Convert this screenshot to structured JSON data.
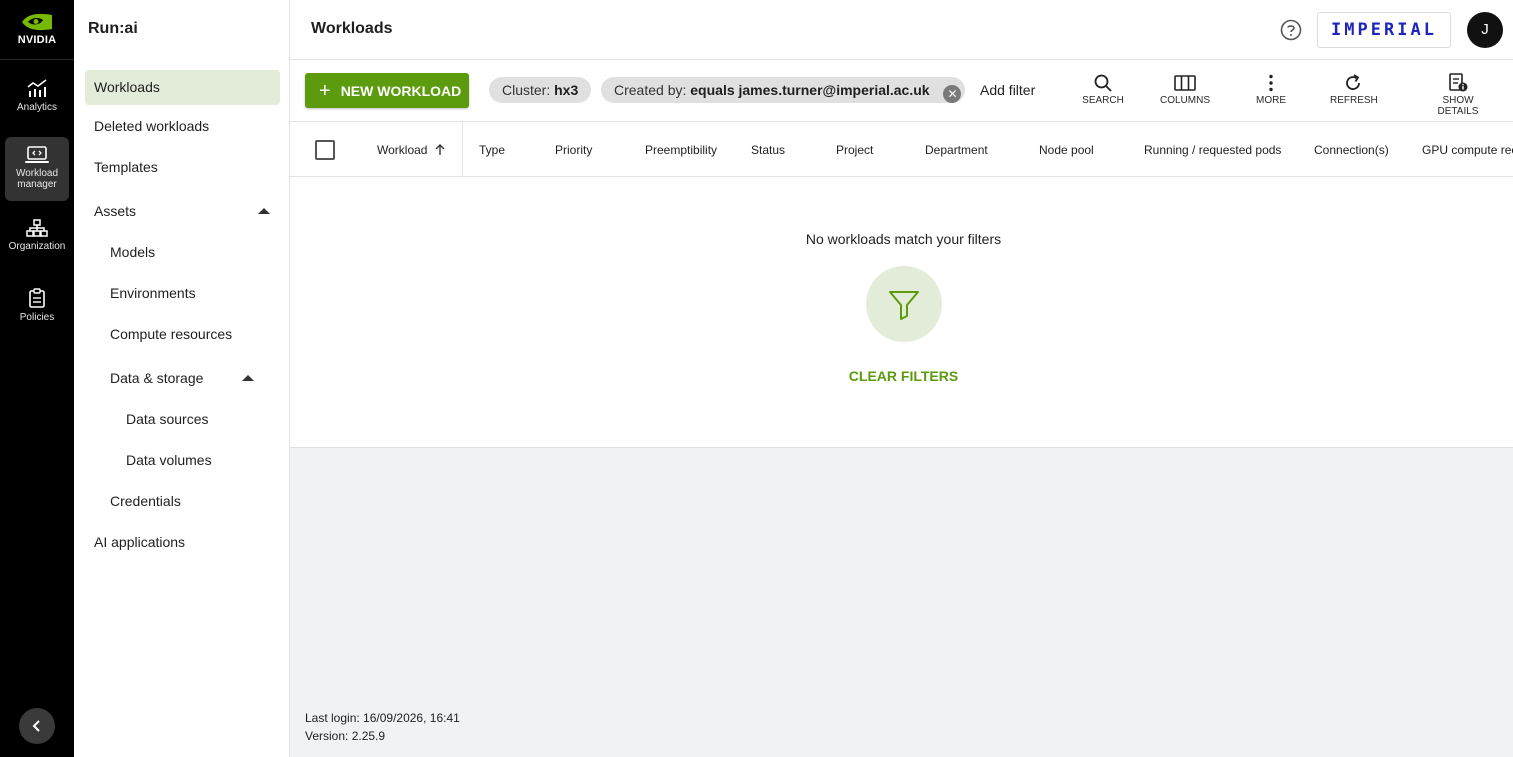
{
  "rail": {
    "brand": "NVIDIA",
    "items": [
      {
        "label": "Analytics",
        "icon": "analytics-icon"
      },
      {
        "label": "Workload manager",
        "icon": "laptop-code-icon"
      },
      {
        "label": "Organization",
        "icon": "org-chart-icon"
      },
      {
        "label": "Policies",
        "icon": "clipboard-icon"
      }
    ]
  },
  "subnav": {
    "title": "Run:ai",
    "items": {
      "workloads": "Workloads",
      "deleted": "Deleted workloads",
      "templates": "Templates",
      "assets": "Assets",
      "models": "Models",
      "environments": "Environments",
      "compute": "Compute resources",
      "data_storage": "Data & storage",
      "data_sources": "Data sources",
      "data_volumes": "Data volumes",
      "credentials": "Credentials",
      "ai_apps": "AI applications"
    }
  },
  "header": {
    "title": "Workloads",
    "org_logo": "IMPERIAL",
    "avatar_initial": "J"
  },
  "toolbar": {
    "new_workload": "NEW WORKLOAD",
    "chip_cluster_key": "Cluster:",
    "chip_cluster_value": "hx3",
    "chip_creator_key": "Created by:",
    "chip_creator_value": "equals james.turner@imperial.ac.uk",
    "add_filter": "Add filter",
    "tools": {
      "search": "SEARCH",
      "columns": "COLUMNS",
      "more": "MORE",
      "refresh": "REFRESH",
      "show_details": "SHOW DETAILS"
    }
  },
  "table": {
    "columns": [
      "Workload",
      "Type",
      "Priority",
      "Preemptibility",
      "Status",
      "Project",
      "Department",
      "Node pool",
      "Running / requested pods",
      "Connection(s)",
      "GPU compute rec"
    ],
    "empty_message": "No workloads match your filters",
    "clear_filters": "CLEAR FILTERS"
  },
  "footer": {
    "last_login": "Last login: 16/09/2026, 16:41",
    "version": "Version: 2.25.9"
  },
  "colors": {
    "accent": "#5b9b0d",
    "accent_light": "#e3ebd9",
    "rail_bg": "#000000",
    "org_logo": "#1e25b8"
  }
}
